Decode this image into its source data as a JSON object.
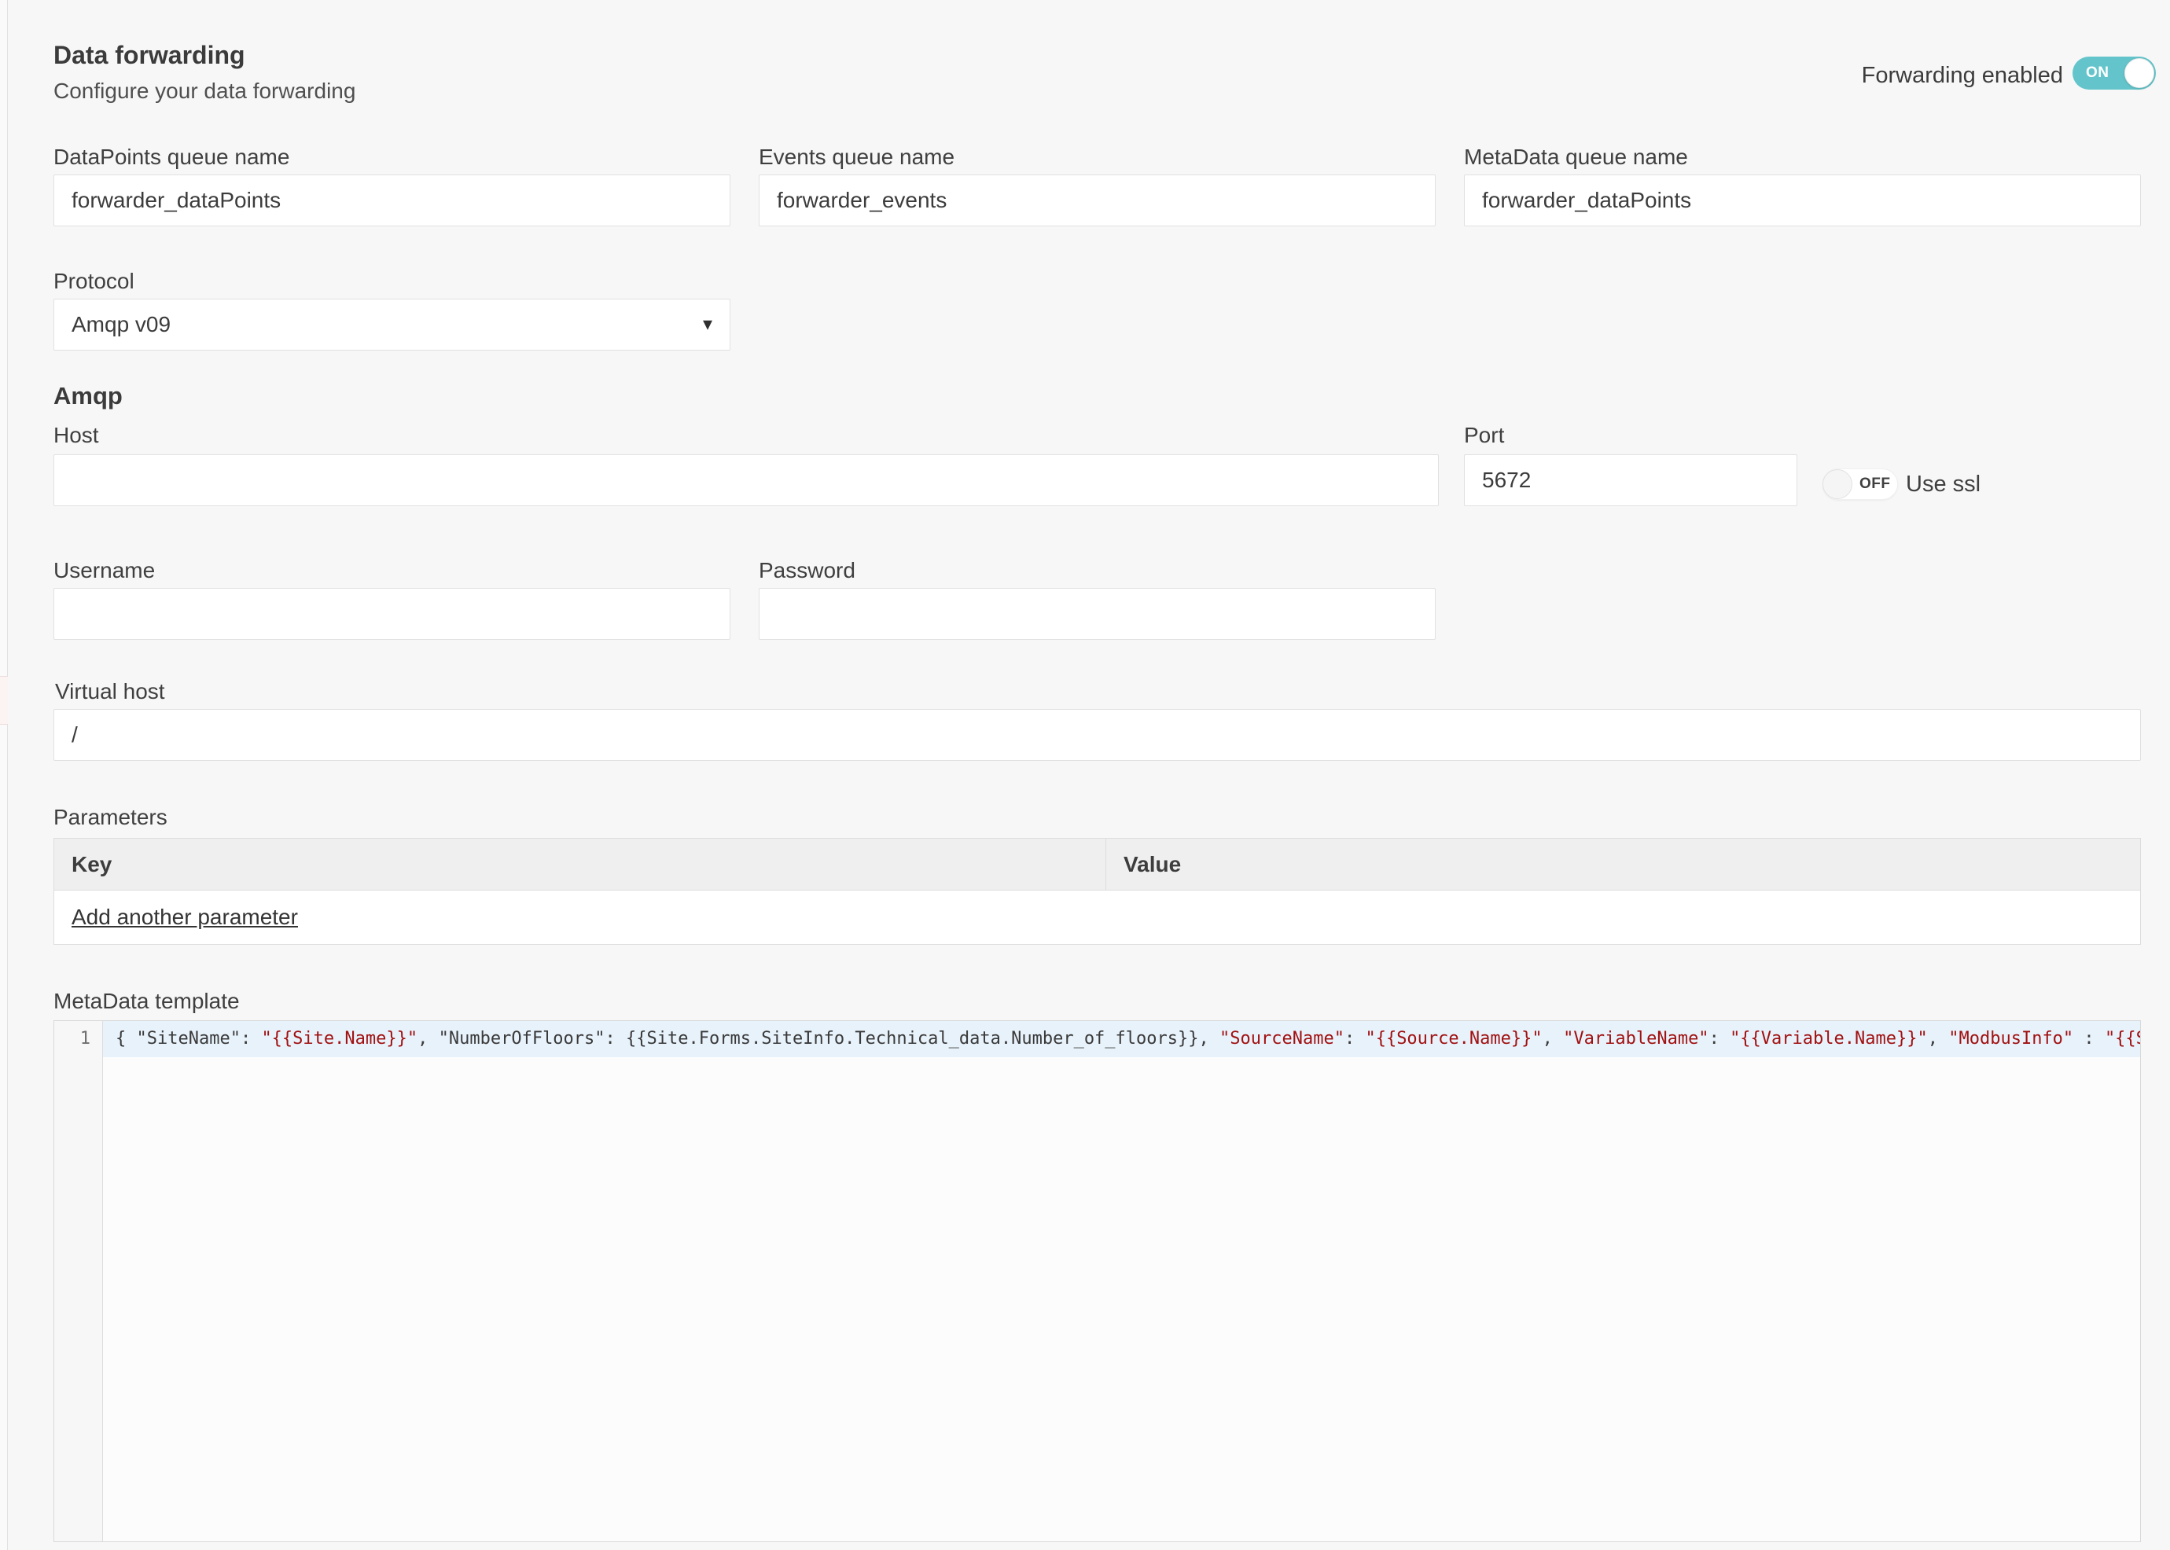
{
  "header": {
    "title": "Data forwarding",
    "subtitle": "Configure your data forwarding",
    "forwarding_toggle_label": "Forwarding enabled",
    "forwarding_toggle_state": "ON"
  },
  "queue_fields": [
    {
      "label": "DataPoints queue name",
      "value": "forwarder_dataPoints"
    },
    {
      "label": "Events queue name",
      "value": "forwarder_events"
    },
    {
      "label": "MetaData queue name",
      "value": "forwarder_dataPoints"
    }
  ],
  "protocol": {
    "label": "Protocol",
    "selected": "Amqp v09",
    "caret_icon": "▾"
  },
  "amqp": {
    "section_title": "Amqp",
    "host": {
      "label": "Host",
      "value": ""
    },
    "port": {
      "label": "Port",
      "value": "5672"
    },
    "ssl": {
      "label": "Use ssl",
      "state": "OFF"
    },
    "username": {
      "label": "Username",
      "value": ""
    },
    "password": {
      "label": "Password",
      "value": ""
    },
    "virtual_host": {
      "label": "Virtual host",
      "value": "/"
    }
  },
  "parameters": {
    "label": "Parameters",
    "columns": [
      "Key",
      "Value"
    ],
    "add_link": "Add another parameter"
  },
  "metadata_template": {
    "label": "MetaData template",
    "line_number": "1",
    "code_tokens": [
      {
        "text": "{ \"SiteName\": ",
        "color": "dark"
      },
      {
        "text": "\"{{Site.Name}}\"",
        "color": "red"
      },
      {
        "text": ", \"NumberOfFloors\": {{Site.Forms.SiteInfo.Technical_data.Number_of_floors}}, ",
        "color": "dark"
      },
      {
        "text": "\"SourceName\"",
        "color": "red"
      },
      {
        "text": ": ",
        "color": "dark"
      },
      {
        "text": "\"{{Source.Name}}\"",
        "color": "red"
      },
      {
        "text": ", ",
        "color": "dark"
      },
      {
        "text": "\"VariableName\"",
        "color": "red"
      },
      {
        "text": ": ",
        "color": "dark"
      },
      {
        "text": "\"{{Variable.Name}}\"",
        "color": "red"
      },
      {
        "text": ", ",
        "color": "dark"
      },
      {
        "text": "\"ModbusInfo\"",
        "color": "red"
      },
      {
        "text": " : ",
        "color": "dark"
      },
      {
        "text": "\"{{S",
        "color": "red"
      }
    ],
    "token_colors": {
      "dark": "#3a3a3a",
      "red": "#a11111"
    }
  },
  "colors": {
    "toggle_on": "#63c5cb",
    "active_line": "#e8f2fb",
    "page_background": "#f7f7f7",
    "accent_red_string": "#a11111"
  }
}
